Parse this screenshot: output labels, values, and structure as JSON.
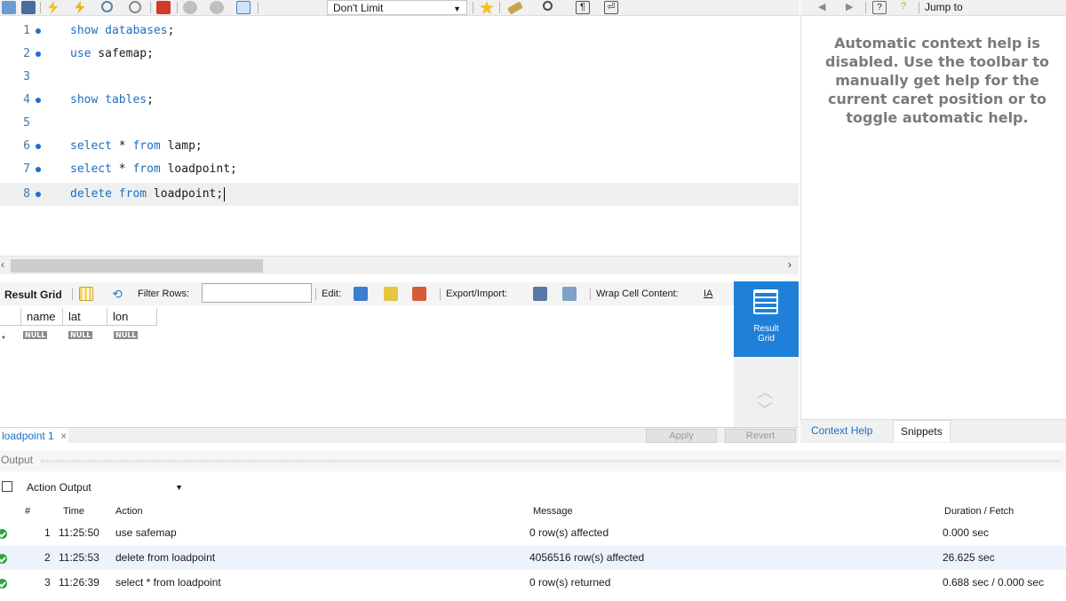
{
  "toolbar": {
    "limit_value": "Don't Limit",
    "icons": [
      "open-file-icon",
      "save-icon",
      "execute-icon",
      "execute-current-icon",
      "explain-icon",
      "stop-icon",
      "toggle-error-icon",
      "commit-icon",
      "rollback-icon",
      "autocommit-icon",
      "limit-dropdown",
      "bookmark-icon",
      "beautify-icon",
      "find-icon",
      "invisible-chars-icon",
      "wrap-icon"
    ]
  },
  "context_toolbar": {
    "jump_to": "Jump to"
  },
  "editor": {
    "lines": [
      {
        "num": "1",
        "keyword": "show databases",
        "rest": ";"
      },
      {
        "num": "2",
        "keyword": "use",
        "rest": " safemap;"
      },
      {
        "num": "3"
      },
      {
        "num": "4",
        "keyword": "show tables",
        "rest": ";"
      },
      {
        "num": "5"
      },
      {
        "num": "6",
        "keyword": "select",
        "rest": " * ",
        "keyword2": "from",
        "rest2": " lamp;"
      },
      {
        "num": "7",
        "keyword": "select",
        "rest": " * ",
        "keyword2": "from",
        "rest2": " loadpoint;"
      },
      {
        "num": "8",
        "keyword": "delete from",
        "rest": " loadpoint;"
      }
    ]
  },
  "result_toolbar": {
    "result_grid": "Result Grid",
    "filter_rows": "Filter Rows:",
    "edit": "Edit:",
    "export_import": "Export/Import:",
    "wrap_cell": "Wrap Cell Content:"
  },
  "grid": {
    "columns": [
      "name",
      "lat",
      "lon"
    ],
    "null_label": "NULL",
    "new_row_marker": "*"
  },
  "result_side": {
    "result_grid_label_1": "Result",
    "result_grid_label_2": "Grid"
  },
  "result_tabs": {
    "active_tab": "loadpoint 1",
    "close": "×",
    "apply": "Apply",
    "revert": "Revert"
  },
  "context_help": {
    "message": "Automatic context help is disabled. Use the toolbar to manually get help for the current caret position or to toggle automatic help.",
    "tabs": [
      "Context Help",
      "Snippets"
    ]
  },
  "output": {
    "title": "Output",
    "selector": "Action Output",
    "columns": [
      "#",
      "Time",
      "Action",
      "Message",
      "Duration / Fetch"
    ],
    "rows": [
      {
        "num": "1",
        "time": "11:25:50",
        "action": "use safemap",
        "message": "0 row(s) affected",
        "duration": "0.000 sec"
      },
      {
        "num": "2",
        "time": "11:25:53",
        "action": "delete from loadpoint",
        "message": "4056516 row(s) affected",
        "duration": "26.625 sec"
      },
      {
        "num": "3",
        "time": "11:26:39",
        "action": "select * from loadpoint",
        "message": "0 row(s) returned",
        "duration": "0.688 sec / 0.000 sec"
      }
    ]
  },
  "colors": {
    "accent": "#1e80d8",
    "keyword": "#1b6fc0",
    "ok": "#2da53a"
  }
}
